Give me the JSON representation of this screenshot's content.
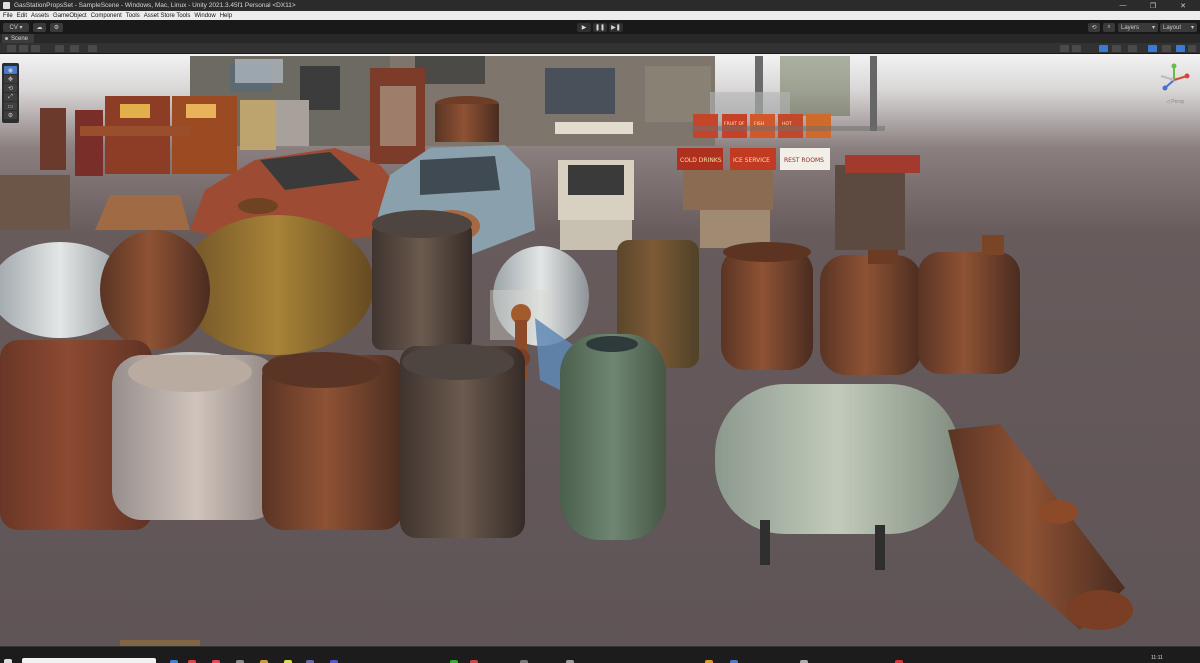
{
  "window": {
    "title": "GasStationPropsSet - SampleScene - Windows, Mac, Linux - Unity 2021.3.45f1 Personal <DX11>",
    "controls": [
      "—",
      "❐",
      "✕"
    ]
  },
  "menu": [
    "File",
    "Edit",
    "Assets",
    "GameObject",
    "Component",
    "Tools",
    "Asset Store Tools",
    "Window",
    "Help"
  ],
  "toolbar": {
    "account_label": "CV ▾",
    "play_icons": [
      "▶",
      "❚❚",
      "▶❚"
    ],
    "layers_label": "Layers",
    "layout_label": "Layout"
  },
  "scene": {
    "tab_label": "Scene",
    "tools": [
      "◉",
      "✥",
      "⟲",
      "⤢",
      "▭",
      "⚙"
    ],
    "gizmo_label": "◁ Persp"
  },
  "props": {
    "signs": [
      "COLD DRINKS",
      "ICE SERVICE",
      "REST ROOMS",
      "FRUIT OF",
      "FISH",
      "HOT"
    ]
  },
  "colors": {
    "titlebar": "#2b2b2b",
    "menubar": "#ececec",
    "viewport_floor": "#5f5456",
    "accent_blue": "#4a79c9",
    "rust": "#8a4b2b"
  },
  "taskbar": {
    "clock": "11:11"
  }
}
